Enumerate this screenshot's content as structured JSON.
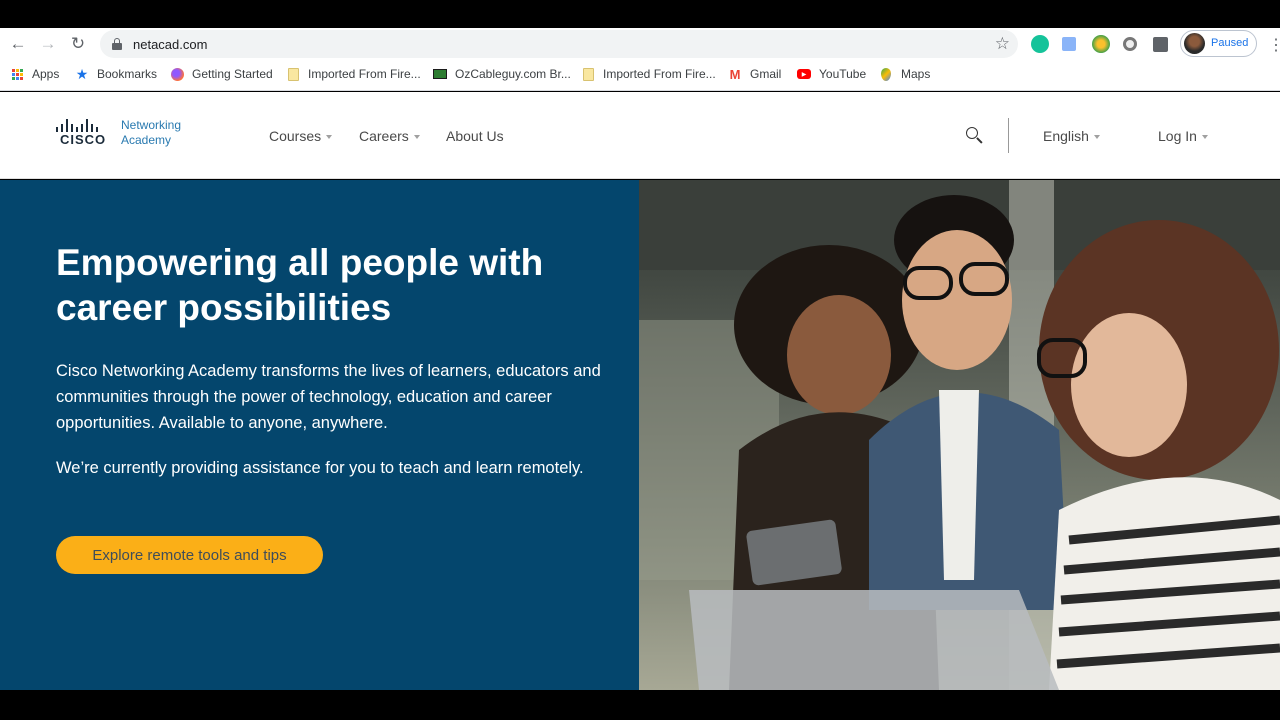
{
  "browser": {
    "url": "netacad.com",
    "profile_status": "Paused",
    "bookmarks": [
      "Apps",
      "Bookmarks",
      "Getting Started",
      "Imported From Fire...",
      "OzCableguy.com Br...",
      "Imported From Fire...",
      "Gmail",
      "YouTube",
      "Maps"
    ]
  },
  "site": {
    "logo_brand": "CISCO",
    "logo_line1": "Networking",
    "logo_line2": "Academy",
    "nav": {
      "courses": "Courses",
      "careers": "Careers",
      "about": "About Us",
      "language": "English",
      "login": "Log In"
    }
  },
  "hero": {
    "title": "Empowering all people with career possibilities",
    "paragraph1": "Cisco Networking Academy transforms the lives of learners, educators and communities through the power of technology, education and career opportunities. Available to anyone, anywhere.",
    "paragraph2": "We’re currently providing assistance for you to teach and learn remotely.",
    "cta_label": "Explore remote tools and tips"
  },
  "colors": {
    "hero_bg": "#04466d",
    "cta_bg": "#fbaf17",
    "logo_blue": "#2a7ab0"
  },
  "icons": {
    "back": "arrow-left-icon",
    "forward": "arrow-right-icon",
    "reload": "reload-icon",
    "lock": "lock-icon",
    "star": "star-icon",
    "search": "search-icon",
    "menu": "kebab-icon"
  }
}
